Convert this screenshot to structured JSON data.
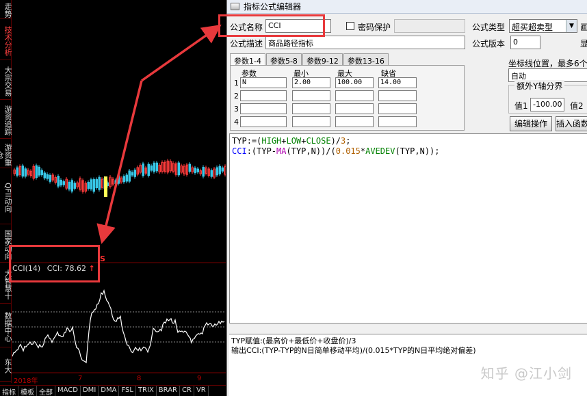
{
  "left_panel": {
    "side_tabs": [
      {
        "label": "走势",
        "active": false
      },
      {
        "label": "技术分析",
        "active": true
      },
      {
        "label": "大宗交易",
        "active": false
      },
      {
        "label": "游资追踪",
        "active": false
      },
      {
        "label": "游资重仓",
        "active": false
      },
      {
        "label": "QFII动向",
        "active": false
      },
      {
        "label": "国家动向",
        "active": false
      },
      {
        "label": "大智慧十",
        "active": false
      },
      {
        "label": "数据中心",
        "active": false
      },
      {
        "label": "东大",
        "active": false
      }
    ],
    "indicator": {
      "name": "CCI(14)",
      "value_text": "CCI: 78.62",
      "arrow": "↑"
    },
    "signal_marker": "S",
    "date_labels": [
      "2018年",
      "7",
      "8",
      "9"
    ],
    "bottom_tabs": [
      "指标",
      "模板",
      "全部",
      "MACD",
      "DMI",
      "DMA",
      "FSL",
      "TRIX",
      "BRAR",
      "CR",
      "VR"
    ]
  },
  "editor": {
    "title": "指标公式编辑器",
    "formula_name_label": "公式名称",
    "formula_name_value": "CCI",
    "password_label": "密码保护",
    "formula_type_label": "公式类型",
    "formula_type_value": "超买超卖型",
    "cut_label_1": "画",
    "description_label": "公式描述",
    "description_value": "商品路径指标",
    "version_label": "公式版本",
    "version_value": "0",
    "cut_label_2": "显",
    "param_tabs": [
      "参数1-4",
      "参数5-8",
      "参数9-12",
      "参数13-16"
    ],
    "param_headers": [
      "参数",
      "最小",
      "最大",
      "缺省"
    ],
    "param_rows": [
      {
        "num": "1",
        "name": "N",
        "min": "2.00",
        "max": "100.00",
        "default": "14.00"
      },
      {
        "num": "2",
        "name": "",
        "min": "",
        "max": "",
        "default": ""
      },
      {
        "num": "3",
        "name": "",
        "min": "",
        "max": "",
        "default": ""
      },
      {
        "num": "4",
        "name": "",
        "min": "",
        "max": "",
        "default": ""
      }
    ],
    "coord_label": "坐标线位置，最多6个，",
    "coord_value": "自动",
    "yaxis_title": "额外Y轴分界",
    "yaxis_val1_label": "值1",
    "yaxis_val1": "-100.00",
    "yaxis_val2_label": "值2",
    "edit_button": "编辑操作",
    "insert_button": "插入函数",
    "code": {
      "line1": {
        "a": "TYP",
        "b": ":=(",
        "c": "HIGH",
        "d": "+",
        "e": "LOW",
        "f": "+",
        "g": "CLOSE",
        "h": ")/",
        "i": "3",
        "j": ";"
      },
      "line2": {
        "a": "CCI",
        "b": ":(TYP-",
        "c": "MA",
        "d": "(TYP,N))/(",
        "e": "0.015",
        "f": "*",
        "g": "AVEDEV",
        "h": "(TYP,",
        "i": "N",
        "j": "));"
      }
    },
    "description_lines": [
      "TYP赋值:(最高价+最低价+收盘价)/3",
      "输出CCI:(TYP-TYP的N日简单移动平均)/(0.015*TYP的N日平均绝对偏差)"
    ],
    "watermark": "知乎 @江小剑"
  },
  "colors": {
    "annotation": "#e8393c",
    "candle_up": "#ff3b3b",
    "candle_down": "#38c8e8",
    "line": "#ffffff"
  }
}
